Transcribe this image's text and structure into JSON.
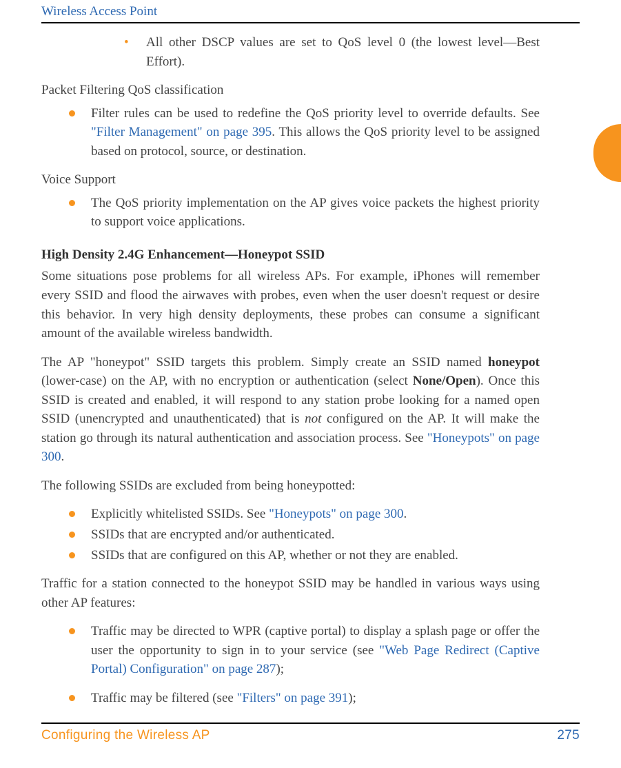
{
  "runningHead": "Wireless Access Point",
  "dscpBullet": {
    "pre": "All other DSCP values are set to QoS level 0 (the lowest level—Best Effort)."
  },
  "pfqHeading": "Packet Filtering QoS classification",
  "filterBullet": {
    "pre": "Filter rules can be used to redefine the QoS priority level to override defaults. See ",
    "link": "\"Filter Management\" on page 395",
    "post": ". This allows the QoS priority level to be assigned based on protocol, source, or destination."
  },
  "voiceHeading": "Voice Support",
  "voiceBullet": "The QoS priority implementation on the AP gives voice packets the highest priority to support voice applications.",
  "honeypotHeading": "High Density 2.4G Enhancement—Honeypot SSID",
  "honeypotP1": "Some situations pose problems for all wireless APs. For example, iPhones will remember every SSID and flood the airwaves with probes, even when the user doesn't request or desire this behavior. In very high density deployments, these probes can consume a significant amount of the available wireless bandwidth.",
  "honeypotP2": {
    "a": "The AP \"honeypot\" SSID targets this problem. Simply create an SSID named ",
    "bold1": "honeypot",
    "b": " (lower-case) on the AP, with no encryption or authentication (select ",
    "bold2": "None/Open",
    "c": "). Once this SSID is created and enabled, it will respond to any station probe looking for a named open SSID (unencrypted and unauthenticated) that is ",
    "ital": "not",
    "d": " configured on the AP. It will make the station go through its natural authentication and association process. See ",
    "link": "\"Honeypots\" on page 300",
    "e": "."
  },
  "excludedIntro": "The following SSIDs are excluded from being honeypotted:",
  "exclWhite": {
    "pre": "Explicitly whitelisted SSIDs. See ",
    "link": "\"Honeypots\" on page 300",
    "post": "."
  },
  "exclEnc": "SSIDs that are encrypted and/or authenticated.",
  "exclCfg": "SSIDs that are configured on this AP, whether or not they are enabled.",
  "trafficIntro": "Traffic for a station connected to the honeypot SSID may be handled in various ways using other AP features:",
  "trafWpr": {
    "pre": "Traffic may be directed to WPR (captive portal) to display a splash page or offer the user the opportunity to sign in to your service (see ",
    "link": "\"Web Page Redirect (Captive Portal) Configuration\" on page 287",
    "post": ");"
  },
  "trafFilter": {
    "pre": "Traffic may be filtered (see ",
    "link": "\"Filters\" on page 391",
    "post": ");"
  },
  "footer": {
    "left": "Configuring the Wireless AP",
    "right": "275"
  }
}
